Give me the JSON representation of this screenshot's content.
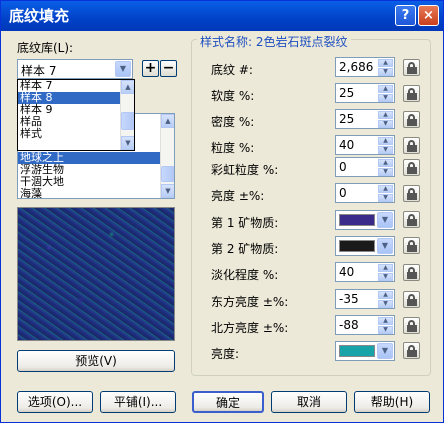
{
  "window": {
    "title": "底纹填充",
    "help": "?",
    "close": "×"
  },
  "library": {
    "label": "底纹库(L):",
    "selected": "样本 7",
    "dropdown_items": [
      "样本 7",
      "样本 8",
      "样本 9",
      "样品",
      "样式"
    ],
    "dropdown_highlight": 1,
    "add": "+",
    "remove": "−"
  },
  "texture_list": {
    "items": [
      "地球之上",
      "浮游生物",
      "干涸大地",
      "海藻"
    ],
    "selected_index": 0
  },
  "preview_button": "预览(V)",
  "style_name": "样式名称: 2色岩石斑点裂纹",
  "params": [
    {
      "label": "底纹 #:",
      "value": "2,686"
    },
    {
      "label": "软度 %:",
      "value": "25"
    },
    {
      "label": "密度 %:",
      "value": "25"
    },
    {
      "label": "粒度 %:",
      "value": "40"
    },
    {
      "label": "彩虹粒度 %:",
      "value": "0"
    },
    {
      "label": "亮度 ±%:",
      "value": "0"
    }
  ],
  "colors": [
    {
      "label": "第 1 矿物质:",
      "swatch": "#3a2a8a"
    },
    {
      "label": "第 2 矿物质:",
      "swatch": "#1a1a1a"
    }
  ],
  "params2": [
    {
      "label": "淡化程度 %:",
      "value": "40"
    },
    {
      "label": "东方亮度 ±%:",
      "value": "-35"
    },
    {
      "label": "北方亮度 ±%:",
      "value": "-88"
    }
  ],
  "brightness": {
    "label": "亮度:",
    "swatch": "#17a3a8"
  },
  "buttons": {
    "options": "选项(O)...",
    "tile": "平铺(I)...",
    "ok": "确定",
    "cancel": "取消",
    "help": "帮助(H)"
  }
}
